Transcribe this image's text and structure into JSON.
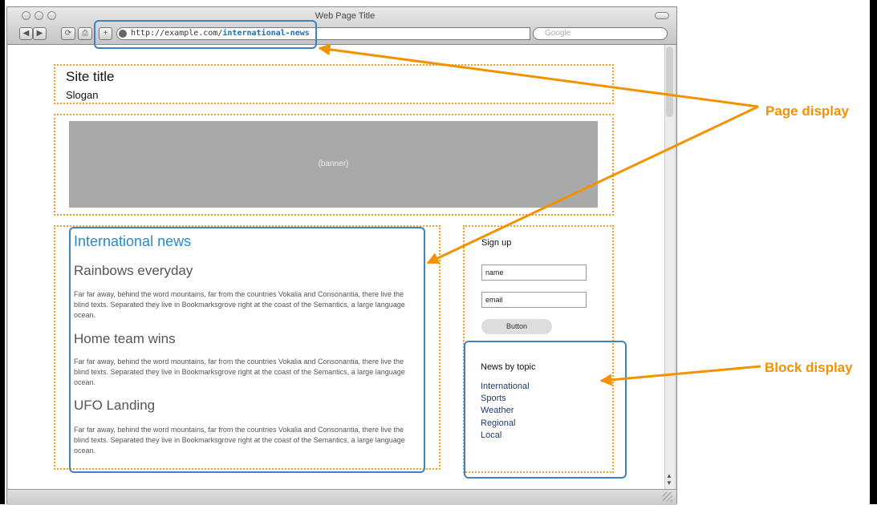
{
  "browser": {
    "window_title": "Web Page Title",
    "url_prefix": "http://example.com/",
    "url_path": "international-news",
    "search_placeholder": "Google",
    "buttons": [
      "◀",
      "▶",
      "⟳",
      "⎙",
      "+"
    ]
  },
  "page": {
    "site_title": "Site title",
    "slogan": "Slogan",
    "banner_text": "(banner)",
    "section_title": "International news",
    "articles": [
      {
        "title": "Rainbows everyday",
        "text": "Far far away, behind the word mountains, far from the countries Vokalia and Consonantia, there live the blind texts. Separated they live in Bookmarksgrove right at the coast of the Semantics, a large language ocean."
      },
      {
        "title": "Home team wins",
        "text": "Far far away, behind the word mountains, far from the countries Vokalia and Consonantia, there live the blind texts. Separated they live in Bookmarksgrove right at the coast of the Semantics, a large language ocean."
      },
      {
        "title": "UFO Landing",
        "text": "Far far away, behind the word mountains, far from the countries Vokalia and Consonantia, there live the blind texts. Separated they live in Bookmarksgrove right at the coast of the Semantics, a large language ocean."
      }
    ],
    "signup": {
      "heading": "Sign up",
      "name_value": "name",
      "email_value": "email",
      "button_label": "Button"
    },
    "topics": {
      "heading": "News by topic",
      "items": [
        "International",
        "Sports",
        "Weather",
        "Regional",
        "Local"
      ]
    }
  },
  "annotations": {
    "page_display": "Page display",
    "block_display": "Block display",
    "arrow_color": "#f39200",
    "highlight_color": "#3d82c3",
    "region_color": "#f0a020"
  }
}
